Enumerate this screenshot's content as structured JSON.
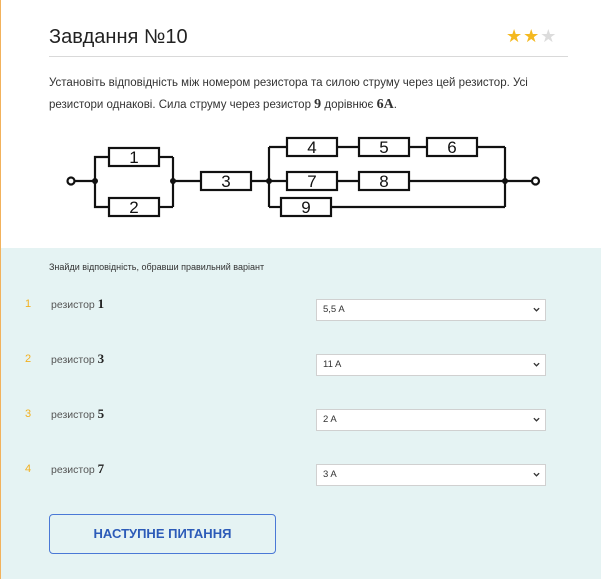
{
  "task": {
    "title": "Завдання №10",
    "rating": {
      "filled": 2,
      "total": 3
    }
  },
  "description": {
    "line1": "Установіть відповідність між номером резистора та силою струму через цей резистор. Усі",
    "line2_prefix": "резистори однакові. Сила струму через резистор ",
    "resistor_number": "9",
    "line2_middle": " дорівнює ",
    "current": "6A",
    "line2_end": "."
  },
  "circuit": {
    "resistor_labels": [
      "1",
      "2",
      "3",
      "4",
      "5",
      "6",
      "7",
      "8",
      "9"
    ]
  },
  "instruction": "Знайди відповідність, обравши правильний варіант",
  "rows": [
    {
      "num": "1",
      "label": "резистор ",
      "resistor": "1",
      "selected": "5,5 A"
    },
    {
      "num": "2",
      "label": "резистор ",
      "resistor": "3",
      "selected": "11 A"
    },
    {
      "num": "3",
      "label": "резистор ",
      "resistor": "5",
      "selected": "2 A"
    },
    {
      "num": "4",
      "label": "резистор ",
      "resistor": "7",
      "selected": "3 A"
    }
  ],
  "next_button": "НАСТУПНЕ ПИТАННЯ",
  "colors": {
    "accent": "#f2b020",
    "button": "#2c5bb8",
    "answer_bg": "#e5f3f3",
    "star_filled": "#f4b921",
    "star_empty": "#dcdcdc"
  }
}
